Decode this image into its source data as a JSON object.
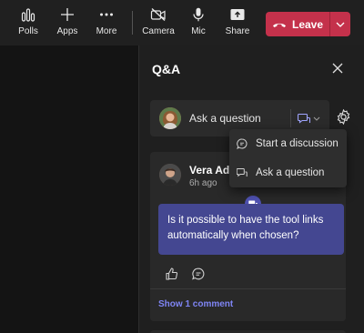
{
  "toolbar": {
    "polls": "Polls",
    "apps": "Apps",
    "more": "More",
    "camera": "Camera",
    "mic": "Mic",
    "share": "Share",
    "leave": "Leave"
  },
  "panel": {
    "title": "Q&A",
    "ask_placeholder": "Ask a question"
  },
  "menu": {
    "items": [
      {
        "label": "Start a discussion",
        "icon": "discussion-icon"
      },
      {
        "label": "Ask a question",
        "icon": "question-icon"
      }
    ]
  },
  "post": {
    "author": "Vera Ada",
    "time": "6h ago",
    "question": "Is it possible to have the tool links automatically when chosen?",
    "show_comment": "Show 1 comment"
  },
  "colors": {
    "leave": "#c4314b",
    "bubble": "#444791",
    "link": "#7f85f5",
    "badge": "#4f52b2"
  }
}
